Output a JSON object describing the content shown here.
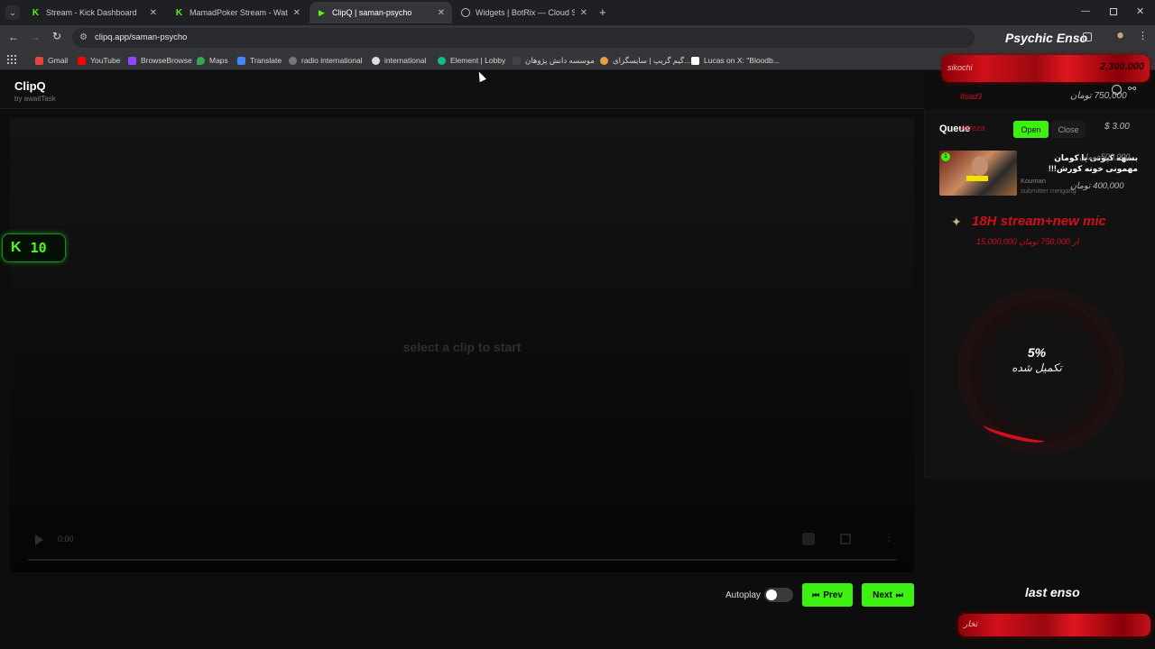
{
  "browser": {
    "tabs": [
      {
        "title": "Stream - Kick Dashboard",
        "icon": "kick-icon"
      },
      {
        "title": "MamadPoker Stream - Watch L",
        "icon": "kick-icon"
      },
      {
        "title": "ClipQ | saman-psycho",
        "icon": "play-icon"
      },
      {
        "title": "Widgets | BotRix — Cloud Strea",
        "icon": "botrix-icon"
      }
    ],
    "url": "clipq.app/saman-psycho",
    "bookmarks": [
      "Gmail",
      "YouTube",
      "BrowseBrowse",
      "Maps",
      "Translate",
      "radio international",
      "international",
      "Element | Lobby",
      "موسسه دانش پژوهان",
      "گیم گریپ | سایسگزای...",
      "Lucas on X: \"Bloodb..."
    ]
  },
  "app": {
    "name": "ClipQ",
    "byline": "by awaitTask",
    "placeholder": "select a clip to start",
    "time": "0:00",
    "autoplay_label": "Autoplay",
    "prev_label": "Prev",
    "next_label": "Next",
    "queue_title": "Queue",
    "open_label": "Open",
    "close_label": "Close",
    "queue_item": {
      "index": "1",
      "title": "بسهه کیوتی یا کومان مهمونی خونه کورش!!!",
      "channel": "Kouman",
      "submitter": "submitter meigang"
    }
  },
  "kick_badge": {
    "count": "10"
  },
  "overlay": {
    "brand": "Psychic Enso",
    "top_donor_name": "sikochi",
    "top_donor_amount": "2,300,000",
    "donor2_name": "Ilsad3",
    "donor2_amount": "750,000 تومان",
    "donor3_name": "Alireza",
    "donor3_amount": "$ 3.00",
    "donor4_amount": "500,000 تومان",
    "donor5_amount": "400,000 تومان",
    "goal_title": "18H stream+new mic",
    "goal_sub": "15,000,000 از 750,000 تومان",
    "goal_percent": "5%",
    "goal_done_label": "تکمیل شده",
    "goal_progress": 0.05,
    "last_title": "last enso",
    "last_name": "تخار"
  },
  "colors": {
    "accent_green": "#3cf00f",
    "kick_green": "#53fc18",
    "overlay_red": "#d0101a"
  }
}
